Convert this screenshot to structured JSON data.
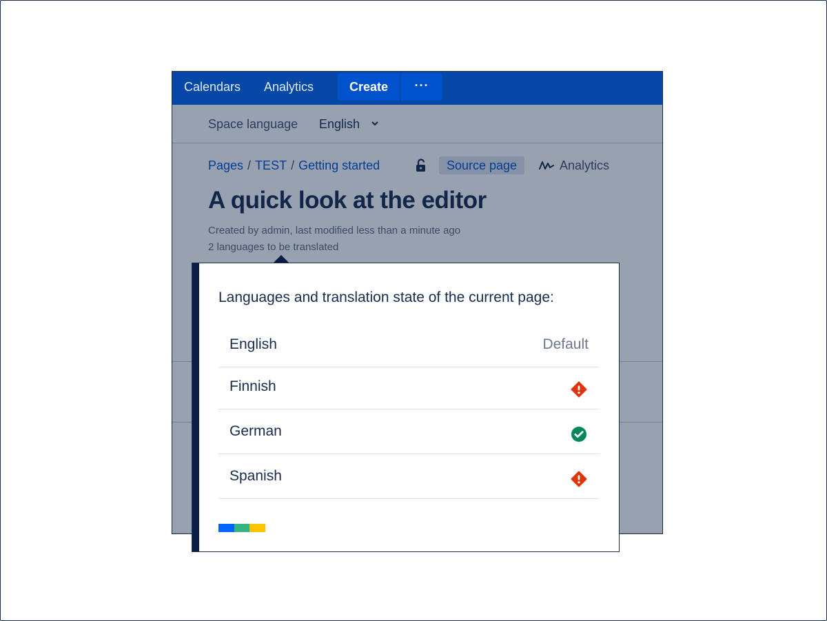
{
  "nav": {
    "calendars": "Calendars",
    "analytics": "Analytics",
    "create": "Create",
    "more": "···"
  },
  "space_language": {
    "label": "Space language",
    "value": "English"
  },
  "breadcrumb": [
    "Pages",
    "TEST",
    "Getting started"
  ],
  "breadcrumb_separator": "/",
  "source_page": "Source page",
  "analytics_link": "Analytics",
  "page": {
    "title": "A quick look at the editor",
    "byline": "Created by admin, last modified less than a minute ago",
    "translation_count": "2 languages to be translated"
  },
  "popup": {
    "title": "Languages and translation state of the current page:",
    "languages": [
      {
        "name": "English",
        "status_text": "Default"
      },
      {
        "name": "Finnish",
        "status_icon": "warning-icon"
      },
      {
        "name": "German",
        "status_icon": "check-circle-icon"
      },
      {
        "name": "Spanish",
        "status_icon": "warning-icon"
      }
    ]
  },
  "colors": {
    "nav_bg": "#0747a6",
    "create_bg": "#0052cc",
    "warning": "#de350b",
    "success": "#00875a",
    "brand_blue": "#0065ff",
    "brand_green": "#36b37e",
    "brand_yellow": "#ffc400"
  }
}
